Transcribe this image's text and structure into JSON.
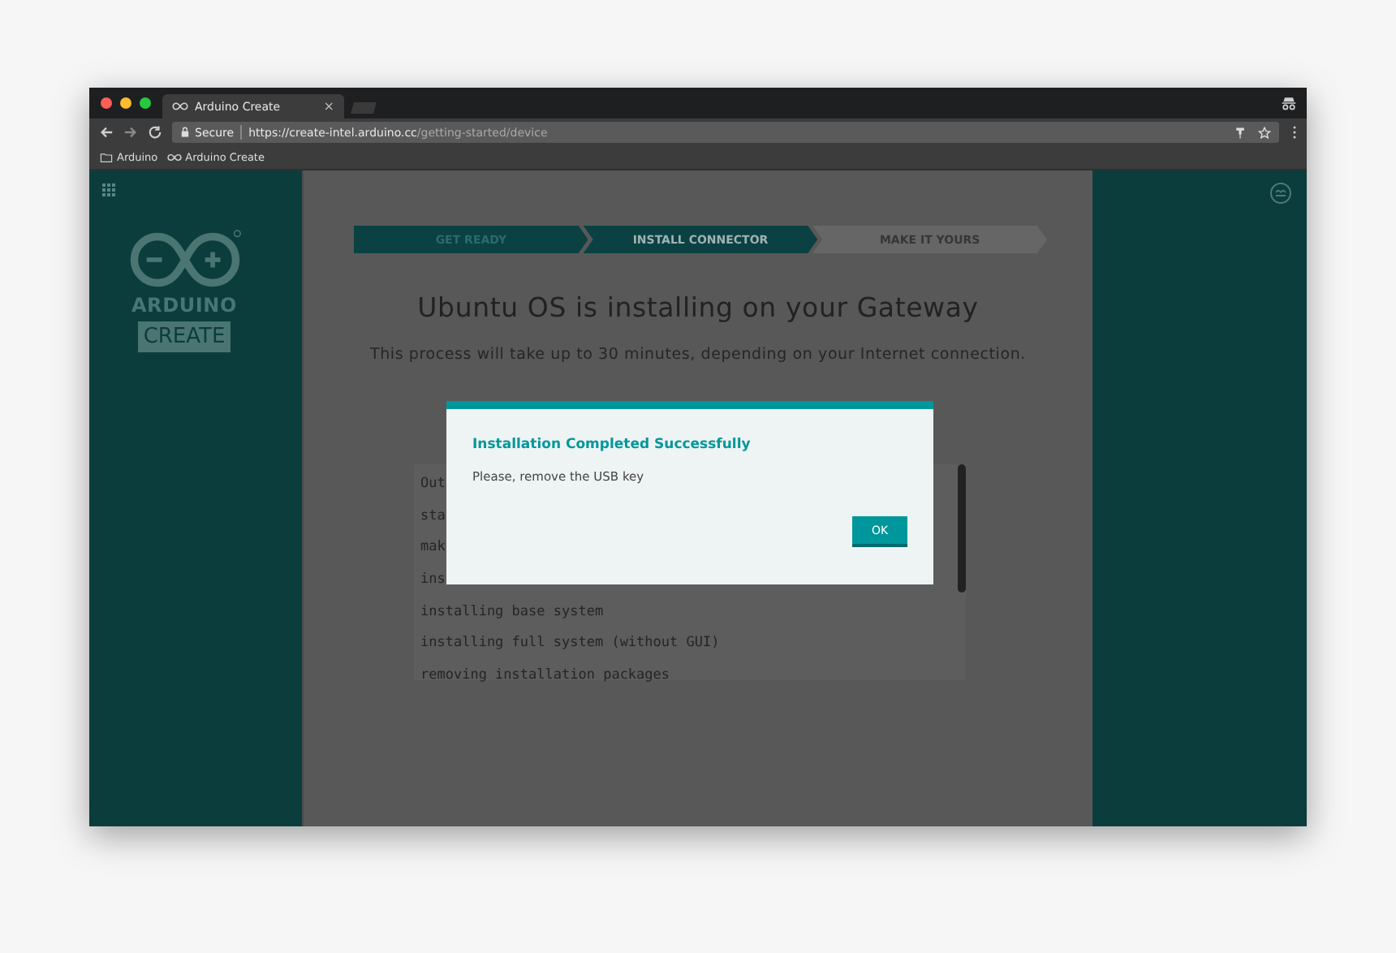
{
  "browser": {
    "tab": {
      "title": "Arduino Create",
      "close": "×"
    },
    "address": {
      "secure_label": "Secure",
      "url_host": "https://create-intel.arduino.cc",
      "url_path": "/getting-started/device"
    },
    "bookmarks": [
      {
        "label": "Arduino",
        "kind": "folder"
      },
      {
        "label": "Arduino Create",
        "kind": "site"
      }
    ]
  },
  "sidebar": {
    "logo_word": "ARDUINO",
    "logo_badge": "CREATE"
  },
  "steps": [
    {
      "label": "GET READY",
      "selected": false
    },
    {
      "label": "INSTALL CONNECTOR",
      "selected": true
    },
    {
      "label": "MAKE IT YOURS",
      "selected": false
    }
  ],
  "heading": "Ubuntu OS is installing on your Gateway",
  "subtitle": "This process will take up to 30 minutes, depending on your Internet connection.",
  "log_lines": [
    "Out",
    "sta",
    "mak",
    "ins",
    "installing base system",
    "installing full system (without GUI)",
    "removing installation packages"
  ],
  "dialog": {
    "title": "Installation Completed Successfully",
    "message": "Please, remove the USB key",
    "button": "OK"
  }
}
